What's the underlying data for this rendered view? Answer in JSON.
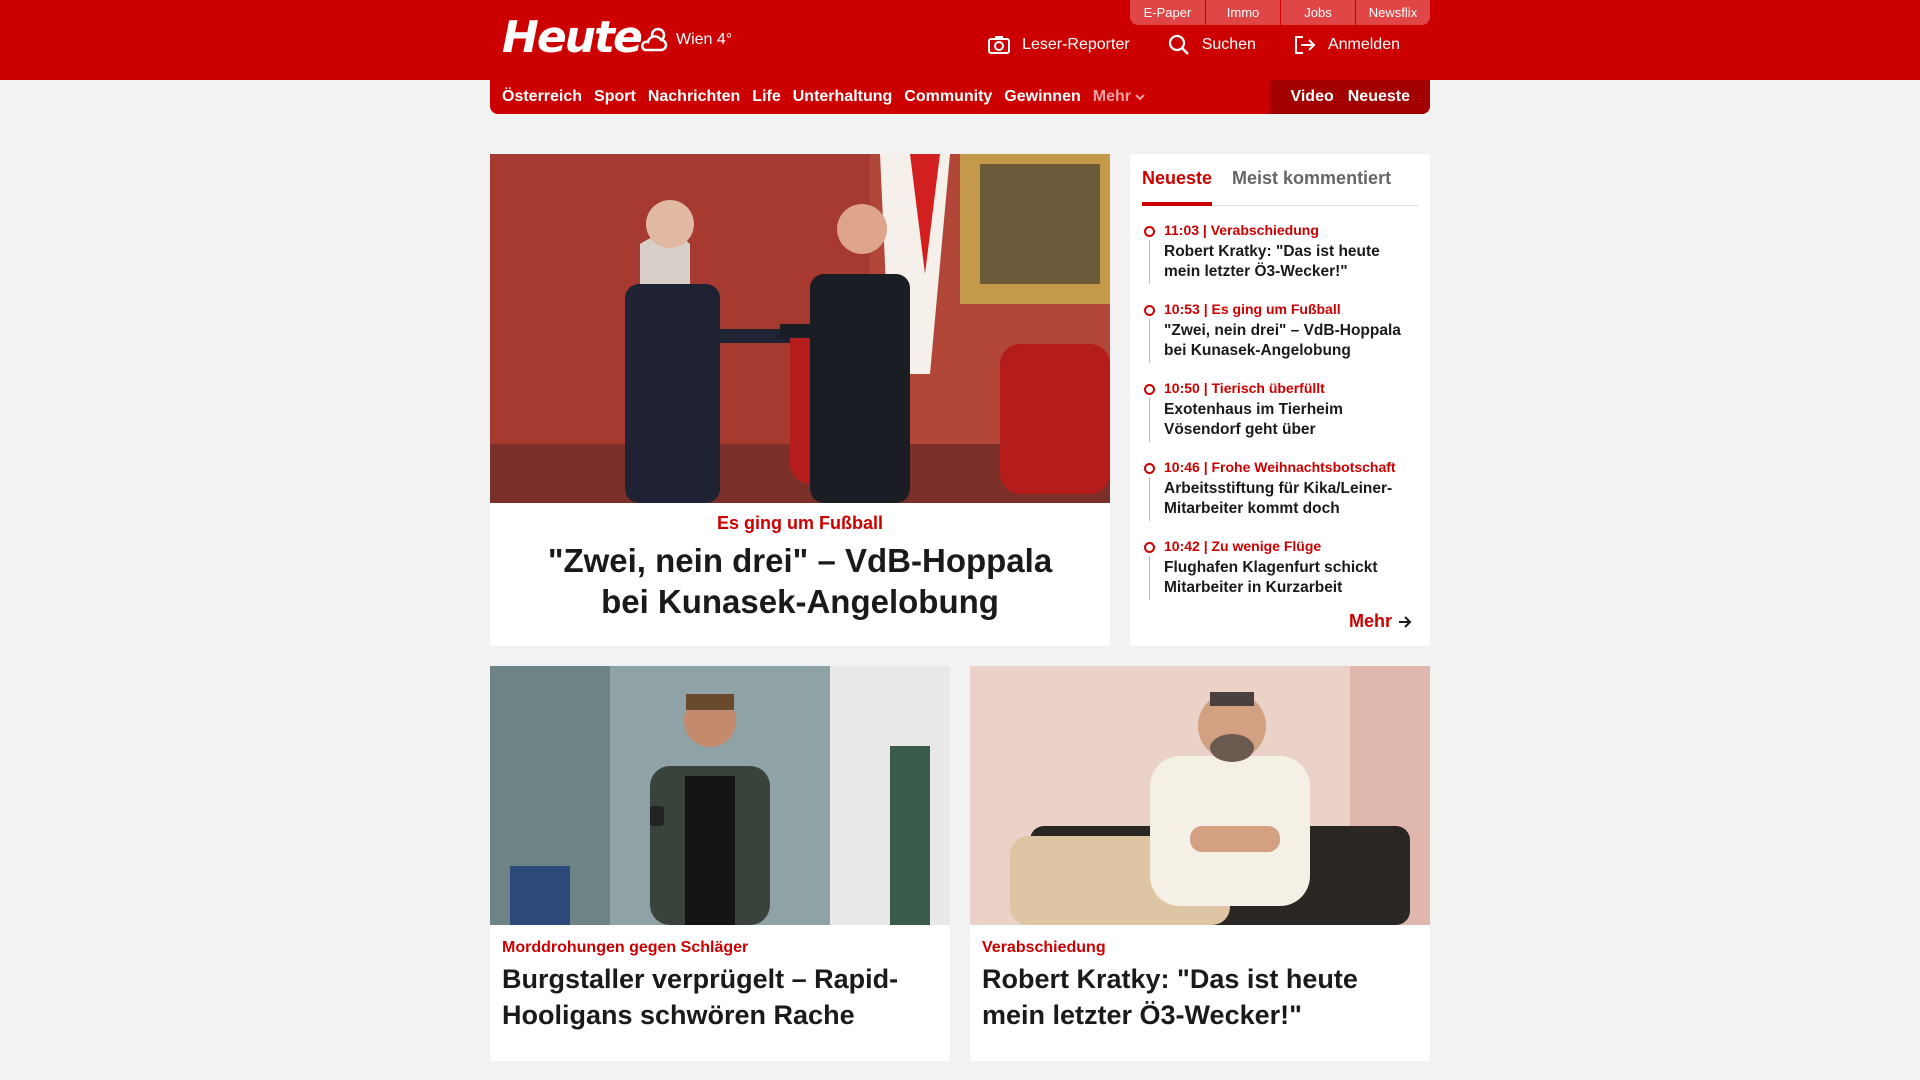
{
  "header": {
    "logo": "Heute",
    "weather": "Wien 4°",
    "service_links": [
      "E-Paper",
      "Immo",
      "Jobs",
      "Newsflix"
    ],
    "actions": {
      "reporter": "Leser-Reporter",
      "search": "Suchen",
      "login": "Anmelden"
    }
  },
  "nav": {
    "items": [
      "Österreich",
      "Sport",
      "Nachrichten",
      "Life",
      "Unterhaltung",
      "Community",
      "Gewinnen"
    ],
    "more": "Mehr",
    "video": "Video",
    "latest": "Neueste"
  },
  "hero": {
    "kicker": "Es ging um Fußball",
    "title": "\"Zwei, nein drei\" – VdB-Hoppala bei Kunasek-Angelobung"
  },
  "sidebar": {
    "tabs": [
      "Neueste",
      "Meist kommentiert"
    ],
    "items": [
      {
        "meta": "11:03 | Verabschiedung",
        "title": "Robert Kratky: \"Das ist heute mein letzter Ö3-Wecker!\""
      },
      {
        "meta": "10:53 | Es ging um Fußball",
        "title": "\"Zwei, nein drei\" – VdB-Hoppala bei Kunasek-Angelobung"
      },
      {
        "meta": "10:50 | Tierisch überfüllt",
        "title": "Exotenhaus im Tierheim Vösendorf geht über"
      },
      {
        "meta": "10:46 | Frohe Weihnachtsbotschaft",
        "title": "Arbeitsstiftung für Kika/Leiner-Mitarbeiter kommt doch"
      },
      {
        "meta": "10:42 | Zu wenige Flüge",
        "title": "Flughafen Klagenfurt schickt Mitarbeiter in Kurzarbeit"
      }
    ],
    "more": "Mehr"
  },
  "cards": [
    {
      "kicker": "Morddrohungen gegen Schläger",
      "title": "Burgstaller verprügelt – Rapid-Hooligans schwören Rache"
    },
    {
      "kicker": "Verabschiedung",
      "title": "Robert Kratky: \"Das ist heute mein letzter Ö3-Wecker!\""
    }
  ],
  "colors": {
    "brand": "#cc0000",
    "brand_dark": "#a30000",
    "background": "#f2f2f2"
  }
}
